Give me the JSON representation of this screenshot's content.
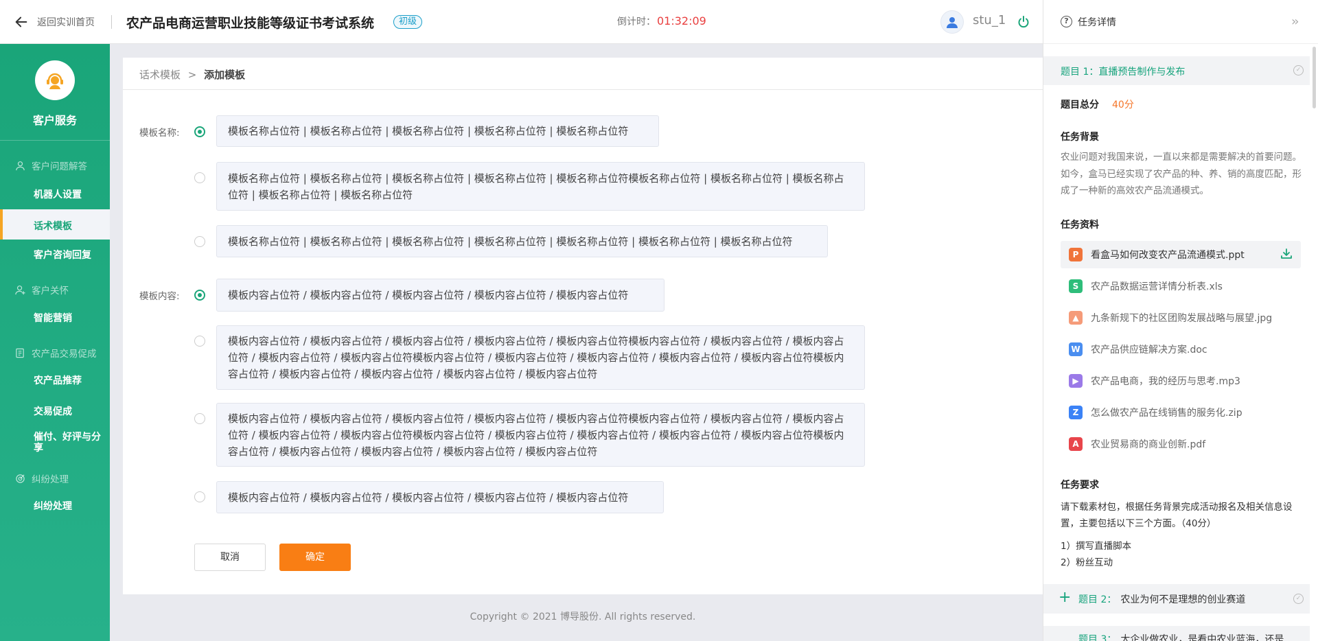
{
  "header": {
    "back_label": "返回实训首页",
    "title": "农产品电商运营职业技能等级证书考试系统",
    "level_badge": "初级",
    "countdown_label": "倒计时：",
    "countdown_value": "01:32:09",
    "username": "stu_1"
  },
  "sidebar": {
    "title": "客户服务",
    "groups": [
      {
        "label": "客户问题解答",
        "icon": "user-icon"
      },
      {
        "label": "客户关怀",
        "icon": "user-add-icon"
      },
      {
        "label": "农产品交易促成",
        "icon": "form-icon"
      },
      {
        "label": "纠纷处理",
        "icon": "target-icon"
      }
    ],
    "items": [
      "机器人设置",
      "话术模板",
      "客户咨询回复",
      "智能营销",
      "农产品推荐",
      "交易促成",
      "催付、好评与分享",
      "纠纷处理"
    ],
    "active_item": "话术模板"
  },
  "main": {
    "breadcrumb_parent": "话术模板",
    "breadcrumb_sep": ">",
    "breadcrumb_current": "添加模板",
    "name_label": "模板名称:",
    "content_label": "模板内容:",
    "name_options": [
      "模板名称占位符 | 模板名称占位符 | 模板名称占位符 | 模板名称占位符 | 模板名称占位符",
      "模板名称占位符 | 模板名称占位符 | 模板名称占位符 | 模板名称占位符 | 模板名称占位符模板名称占位符 | 模板名称占位符 | 模板名称占位符 | 模板名称占位符 | 模板名称占位符",
      "模板名称占位符 | 模板名称占位符 | 模板名称占位符 | 模板名称占位符 | 模板名称占位符 | 模板名称占位符 | 模板名称占位符"
    ],
    "content_options": [
      "模板内容占位符 / 模板内容占位符 / 模板内容占位符 / 模板内容占位符 / 模板内容占位符",
      "模板内容占位符 / 模板内容占位符 / 模板内容占位符 / 模板内容占位符 / 模板内容占位符模板内容占位符 / 模板内容占位符 / 模板内容占位符 / 模板内容占位符 / 模板内容占位符模板内容占位符 / 模板内容占位符 / 模板内容占位符 / 模板内容占位符 / 模板内容占位符模板内容占位符 / 模板内容占位符 / 模板内容占位符 / 模板内容占位符 / 模板内容占位符",
      "模板内容占位符 / 模板内容占位符 / 模板内容占位符 / 模板内容占位符 / 模板内容占位符模板内容占位符 / 模板内容占位符 / 模板内容占位符 / 模板内容占位符 / 模板内容占位符模板内容占位符 / 模板内容占位符 / 模板内容占位符 / 模板内容占位符 / 模板内容占位符模板内容占位符 / 模板内容占位符 / 模板内容占位符 / 模板内容占位符 / 模板内容占位符",
      "模板内容占位符 / 模板内容占位符 / 模板内容占位符 / 模板内容占位符 / 模板内容占位符"
    ],
    "cancel_label": "取消",
    "confirm_label": "确定",
    "copyright": "Copyright © 2021 博导股份. All rights reserved."
  },
  "task_panel": {
    "title": "任务详情",
    "q1_label": "题目 1：",
    "q1_title": "直播预告制作与发布",
    "score_label": "题目总分",
    "score_value": "40分",
    "background_label": "任务背景",
    "background_text": "农业问题对我国来说，一直以来都是需要解决的首要问题。如今，盒马已经实现了农产品的种、养、销的高度匹配，形成了一种新的高效农产品流通模式。",
    "materials_label": "任务资料",
    "files": [
      {
        "name": "看盒马如何改变农产品流通模式.ppt",
        "icon": "ppt-icon",
        "color": "#f0743a"
      },
      {
        "name": "农产品数据运营详情分析表.xls",
        "icon": "xls-icon",
        "color": "#2ebd7a"
      },
      {
        "name": "九条新规下的社区团购发展战略与展望.jpg",
        "icon": "image-icon",
        "color": "#f59b79"
      },
      {
        "name": "农产品供应链解决方案.doc",
        "icon": "doc-icon",
        "color": "#4a8ef0"
      },
      {
        "name": "农产品电商，我的经历与思考.mp3",
        "icon": "audio-icon",
        "color": "#9b7ae8"
      },
      {
        "name": "怎么做农产品在线销售的服务化.zip",
        "icon": "zip-icon",
        "color": "#3b82f6"
      },
      {
        "name": "农业贸易商的商业创新.pdf",
        "icon": "pdf-icon",
        "color": "#e8454b"
      }
    ],
    "requirements_label": "任务要求",
    "requirements_text": "请下载素材包，根据任务背景完成活动报名及相关信息设置，主要包括以下三个方面。（40分）",
    "requirement_items": [
      "1）撰写直播脚本",
      "2）粉丝互动"
    ],
    "q2_label": "题目 2：",
    "q2_title": "农业为何不是理想的创业赛道",
    "q3_label": "题目 3：",
    "q3_title": "大企业做农业，是看中农业蓝海，还是"
  }
}
